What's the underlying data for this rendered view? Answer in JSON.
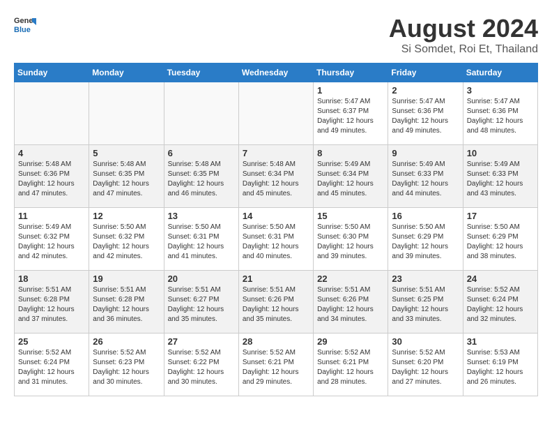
{
  "header": {
    "logo_line1": "General",
    "logo_line2": "Blue",
    "title": "August 2024",
    "subtitle": "Si Somdet, Roi Et, Thailand"
  },
  "weekdays": [
    "Sunday",
    "Monday",
    "Tuesday",
    "Wednesday",
    "Thursday",
    "Friday",
    "Saturday"
  ],
  "weeks": [
    [
      {
        "day": "",
        "info": ""
      },
      {
        "day": "",
        "info": ""
      },
      {
        "day": "",
        "info": ""
      },
      {
        "day": "",
        "info": ""
      },
      {
        "day": "1",
        "info": "Sunrise: 5:47 AM\nSunset: 6:37 PM\nDaylight: 12 hours\nand 49 minutes."
      },
      {
        "day": "2",
        "info": "Sunrise: 5:47 AM\nSunset: 6:36 PM\nDaylight: 12 hours\nand 49 minutes."
      },
      {
        "day": "3",
        "info": "Sunrise: 5:47 AM\nSunset: 6:36 PM\nDaylight: 12 hours\nand 48 minutes."
      }
    ],
    [
      {
        "day": "4",
        "info": "Sunrise: 5:48 AM\nSunset: 6:36 PM\nDaylight: 12 hours\nand 47 minutes."
      },
      {
        "day": "5",
        "info": "Sunrise: 5:48 AM\nSunset: 6:35 PM\nDaylight: 12 hours\nand 47 minutes."
      },
      {
        "day": "6",
        "info": "Sunrise: 5:48 AM\nSunset: 6:35 PM\nDaylight: 12 hours\nand 46 minutes."
      },
      {
        "day": "7",
        "info": "Sunrise: 5:48 AM\nSunset: 6:34 PM\nDaylight: 12 hours\nand 45 minutes."
      },
      {
        "day": "8",
        "info": "Sunrise: 5:49 AM\nSunset: 6:34 PM\nDaylight: 12 hours\nand 45 minutes."
      },
      {
        "day": "9",
        "info": "Sunrise: 5:49 AM\nSunset: 6:33 PM\nDaylight: 12 hours\nand 44 minutes."
      },
      {
        "day": "10",
        "info": "Sunrise: 5:49 AM\nSunset: 6:33 PM\nDaylight: 12 hours\nand 43 minutes."
      }
    ],
    [
      {
        "day": "11",
        "info": "Sunrise: 5:49 AM\nSunset: 6:32 PM\nDaylight: 12 hours\nand 42 minutes."
      },
      {
        "day": "12",
        "info": "Sunrise: 5:50 AM\nSunset: 6:32 PM\nDaylight: 12 hours\nand 42 minutes."
      },
      {
        "day": "13",
        "info": "Sunrise: 5:50 AM\nSunset: 6:31 PM\nDaylight: 12 hours\nand 41 minutes."
      },
      {
        "day": "14",
        "info": "Sunrise: 5:50 AM\nSunset: 6:31 PM\nDaylight: 12 hours\nand 40 minutes."
      },
      {
        "day": "15",
        "info": "Sunrise: 5:50 AM\nSunset: 6:30 PM\nDaylight: 12 hours\nand 39 minutes."
      },
      {
        "day": "16",
        "info": "Sunrise: 5:50 AM\nSunset: 6:29 PM\nDaylight: 12 hours\nand 39 minutes."
      },
      {
        "day": "17",
        "info": "Sunrise: 5:50 AM\nSunset: 6:29 PM\nDaylight: 12 hours\nand 38 minutes."
      }
    ],
    [
      {
        "day": "18",
        "info": "Sunrise: 5:51 AM\nSunset: 6:28 PM\nDaylight: 12 hours\nand 37 minutes."
      },
      {
        "day": "19",
        "info": "Sunrise: 5:51 AM\nSunset: 6:28 PM\nDaylight: 12 hours\nand 36 minutes."
      },
      {
        "day": "20",
        "info": "Sunrise: 5:51 AM\nSunset: 6:27 PM\nDaylight: 12 hours\nand 35 minutes."
      },
      {
        "day": "21",
        "info": "Sunrise: 5:51 AM\nSunset: 6:26 PM\nDaylight: 12 hours\nand 35 minutes."
      },
      {
        "day": "22",
        "info": "Sunrise: 5:51 AM\nSunset: 6:26 PM\nDaylight: 12 hours\nand 34 minutes."
      },
      {
        "day": "23",
        "info": "Sunrise: 5:51 AM\nSunset: 6:25 PM\nDaylight: 12 hours\nand 33 minutes."
      },
      {
        "day": "24",
        "info": "Sunrise: 5:52 AM\nSunset: 6:24 PM\nDaylight: 12 hours\nand 32 minutes."
      }
    ],
    [
      {
        "day": "25",
        "info": "Sunrise: 5:52 AM\nSunset: 6:24 PM\nDaylight: 12 hours\nand 31 minutes."
      },
      {
        "day": "26",
        "info": "Sunrise: 5:52 AM\nSunset: 6:23 PM\nDaylight: 12 hours\nand 30 minutes."
      },
      {
        "day": "27",
        "info": "Sunrise: 5:52 AM\nSunset: 6:22 PM\nDaylight: 12 hours\nand 30 minutes."
      },
      {
        "day": "28",
        "info": "Sunrise: 5:52 AM\nSunset: 6:21 PM\nDaylight: 12 hours\nand 29 minutes."
      },
      {
        "day": "29",
        "info": "Sunrise: 5:52 AM\nSunset: 6:21 PM\nDaylight: 12 hours\nand 28 minutes."
      },
      {
        "day": "30",
        "info": "Sunrise: 5:52 AM\nSunset: 6:20 PM\nDaylight: 12 hours\nand 27 minutes."
      },
      {
        "day": "31",
        "info": "Sunrise: 5:53 AM\nSunset: 6:19 PM\nDaylight: 12 hours\nand 26 minutes."
      }
    ]
  ]
}
